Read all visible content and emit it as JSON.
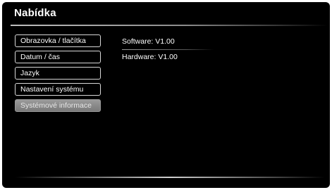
{
  "header": {
    "title": "Nabídka"
  },
  "menu": {
    "items": [
      {
        "label": "Obrazovka / tlačítka"
      },
      {
        "label": "Datum / čas"
      },
      {
        "label": "Jazyk"
      },
      {
        "label": "Nastavení systému"
      },
      {
        "label": "Systémové informace",
        "selected": true
      }
    ]
  },
  "info": {
    "software": "Software: V1.00",
    "hardware": "Hardware: V1.00"
  },
  "colors": {
    "background": "#000000",
    "text": "#ffffff",
    "selected_item": "#8a8a8a"
  }
}
